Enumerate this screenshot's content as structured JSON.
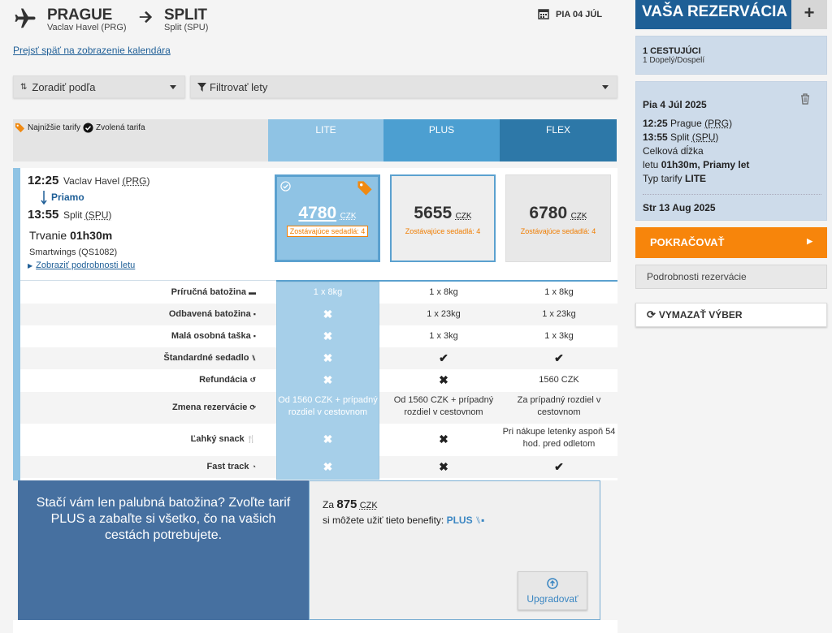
{
  "route": {
    "from_city": "PRAGUE",
    "from_airport": "Vaclav Havel (PRG)",
    "to_city": "SPLIT",
    "to_airport": "Split (SPU)",
    "date": "PIA 04 JÚL"
  },
  "back_link": "Prejsť späť na zobrazenie kalendára",
  "sort": {
    "label": "Zoradiť podľa"
  },
  "filter": {
    "label": "Filtrovať lety"
  },
  "legend": {
    "lowest": "Najnižšie tarify",
    "selected": "Zvolená tarifa"
  },
  "fares": [
    {
      "name": "LITE",
      "color": "#8fc3e4"
    },
    {
      "name": "PLUS",
      "color": "#4c9fd1"
    },
    {
      "name": "FLEX",
      "color": "#2d78a8"
    }
  ],
  "flight": {
    "dep_time": "12:25",
    "dep_airport_pre": "Vaclav Havel ",
    "dep_code": "(PRG)",
    "direct": "Priamo",
    "arr_time": "13:55",
    "arr_airport_pre": "Split ",
    "arr_code": "(SPU)",
    "duration_label": "Trvanie",
    "duration": "01h30m",
    "carrier": "Smartwings (QS1082)",
    "details_link": "Zobraziť podrobnosti letu"
  },
  "prices": [
    {
      "amount": "4780",
      "currency": "CZK",
      "seats": "Zostávajúce sedadlá: 4"
    },
    {
      "amount": "5655",
      "currency": "CZK",
      "seats": "Zostávajúce sedadlá: 4"
    },
    {
      "amount": "6780",
      "currency": "CZK",
      "seats": "Zostávajúce sedadlá: 4"
    }
  ],
  "features": [
    {
      "label": "Príručná batožina",
      "icon": "suitcase-icon",
      "lite": "1 x 8kg",
      "plus": "1 x 8kg",
      "flex": "1 x 8kg"
    },
    {
      "label": "Odbavená batožina",
      "icon": "luggage-icon",
      "lite": "✖",
      "plus": "1 x 23kg",
      "flex": "1 x 23kg"
    },
    {
      "label": "Malá osobná taška",
      "icon": "bag-icon",
      "lite": "✖",
      "plus": "1 x 3kg",
      "flex": "1 x 3kg"
    },
    {
      "label": "Štandardné sedadlo",
      "icon": "seat-icon",
      "lite": "✖",
      "plus": "✔",
      "flex": "✔"
    },
    {
      "label": "Refundácia",
      "icon": "refund-icon",
      "lite": "✖",
      "plus": "✖",
      "flex": "1560 CZK"
    },
    {
      "label": "Zmena rezervácie",
      "icon": "refresh-icon",
      "lite": "Od 1560 CZK + prípadný rozdiel v cestovnom",
      "plus": "Od 1560 CZK + prípadný rozdiel v cestovnom",
      "flex": "Za prípadný rozdiel v cestovnom"
    },
    {
      "label": "Ľahký snack",
      "icon": "food-icon",
      "lite": "✖",
      "plus": "✖",
      "flex": "Pri nákupe letenky aspoň 54 hod. pred odletom"
    },
    {
      "label": "Fast track",
      "icon": "clock-icon",
      "lite": "✖",
      "plus": "✖",
      "flex": "✔"
    }
  ],
  "upsell": {
    "headline": "Stačí vám len palubná batožina? Zvoľte tarif PLUS a zabaľte si všetko, čo na vašich cestách potrebujete.",
    "price_pre": "Za",
    "price": "875",
    "currency": "CZK",
    "benefits_text": "si môžete užiť tieto benefity:",
    "plan": "PLUS",
    "button": "Upgradovať"
  },
  "sidebar": {
    "title": "VAŠA REZERVÁCIA",
    "add": "+",
    "passengers_title": "1 CESTUJÚCI",
    "passengers_detail": "1 Dopelý/Dospelí",
    "outbound_date": "Pia 4 Júl 2025",
    "dep_time": "12:25",
    "dep_city": "Prague",
    "dep_code": "(PRG)",
    "arr_time": "13:55",
    "arr_city": "Split",
    "arr_code": "(SPU)",
    "length_label": "Celková dĺžka",
    "length_pre": "letu",
    "length_value": "01h30m, Priamy let",
    "fare_type_label": "Typ tarify",
    "fare_type": "LITE",
    "return_date": "Str 13 Aug 2025",
    "continue": "POKRAČOVAŤ",
    "details": "Podrobnosti rezervácie",
    "clear": "VYMAZAŤ VÝBER"
  }
}
